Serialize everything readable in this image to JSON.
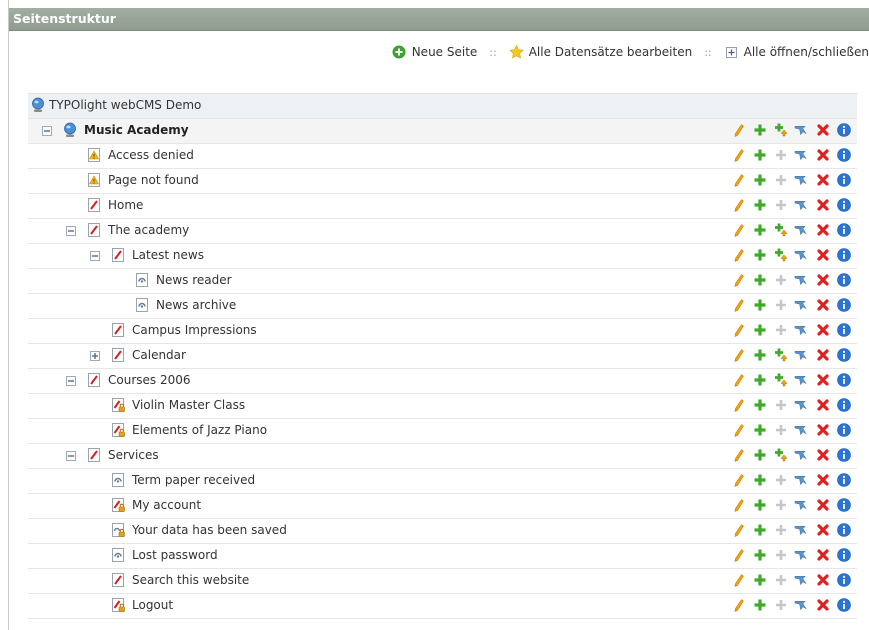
{
  "header": {
    "title": "Seitenstruktur"
  },
  "toolbar": {
    "new_page": "Neue Seite",
    "edit_all": "Alle Datensätze bearbeiten",
    "toggle_all": "Alle öffnen/schließen",
    "separator": "::"
  },
  "tree": {
    "root_label": "TYPOlight webCMS Demo",
    "nodes": [
      {
        "label": "Music Academy",
        "level": 0,
        "icon": "globe-icon",
        "toggle": "collapse",
        "bold": true,
        "paste_into": true
      },
      {
        "label": "Access denied",
        "level": 1,
        "icon": "warning-page-icon",
        "toggle": null,
        "bold": false,
        "paste_into": false
      },
      {
        "label": "Page not found",
        "level": 1,
        "icon": "warning-page-icon",
        "toggle": null,
        "bold": false,
        "paste_into": false
      },
      {
        "label": "Home",
        "level": 1,
        "icon": "regular-page-icon",
        "toggle": null,
        "bold": false,
        "paste_into": false
      },
      {
        "label": "The academy",
        "level": 1,
        "icon": "regular-page-icon",
        "toggle": "collapse",
        "bold": false,
        "paste_into": true
      },
      {
        "label": "Latest news",
        "level": 2,
        "icon": "regular-page-icon",
        "toggle": "collapse",
        "bold": false,
        "paste_into": true
      },
      {
        "label": "News reader",
        "level": 3,
        "icon": "hidden-page-icon",
        "toggle": null,
        "bold": false,
        "paste_into": false
      },
      {
        "label": "News archive",
        "level": 3,
        "icon": "hidden-page-icon",
        "toggle": null,
        "bold": false,
        "paste_into": false
      },
      {
        "label": "Campus Impressions",
        "level": 2,
        "icon": "regular-page-icon",
        "toggle": null,
        "bold": false,
        "paste_into": false
      },
      {
        "label": "Calendar",
        "level": 2,
        "icon": "regular-page-icon",
        "toggle": "expand",
        "bold": false,
        "paste_into": true
      },
      {
        "label": "Courses 2006",
        "level": 1,
        "icon": "regular-page-icon",
        "toggle": "collapse",
        "bold": false,
        "paste_into": true
      },
      {
        "label": "Violin Master Class",
        "level": 2,
        "icon": "protected-page-icon",
        "toggle": null,
        "bold": false,
        "paste_into": false
      },
      {
        "label": "Elements of Jazz Piano",
        "level": 2,
        "icon": "protected-page-icon",
        "toggle": null,
        "bold": false,
        "paste_into": false
      },
      {
        "label": "Services",
        "level": 1,
        "icon": "regular-page-icon",
        "toggle": "collapse",
        "bold": false,
        "paste_into": true
      },
      {
        "label": "Term paper received",
        "level": 2,
        "icon": "hidden-page-icon",
        "toggle": null,
        "bold": false,
        "paste_into": false
      },
      {
        "label": "My account",
        "level": 2,
        "icon": "protected-page-icon",
        "toggle": null,
        "bold": false,
        "paste_into": false
      },
      {
        "label": "Your data has been saved",
        "level": 2,
        "icon": "hidden-protected-page-icon",
        "toggle": null,
        "bold": false,
        "paste_into": false
      },
      {
        "label": "Lost password",
        "level": 2,
        "icon": "hidden-page-icon",
        "toggle": null,
        "bold": false,
        "paste_into": false
      },
      {
        "label": "Search this website",
        "level": 2,
        "icon": "regular-page-icon",
        "toggle": null,
        "bold": false,
        "paste_into": false
      },
      {
        "label": "Logout",
        "level": 2,
        "icon": "protected-page-icon",
        "toggle": null,
        "bold": false,
        "paste_into": false
      }
    ]
  },
  "row_actions": [
    "edit-icon",
    "paste-after-icon",
    "paste-into-icon",
    "cut-icon",
    "delete-icon",
    "info-icon"
  ],
  "colors": {
    "header_bg": "#95a295",
    "root_row_bg": "#eef1f4",
    "edit": "#f2a20a",
    "add": "#3fa92a",
    "delete": "#e02020",
    "info": "#2a73d9",
    "cut": "#5b93c9"
  }
}
